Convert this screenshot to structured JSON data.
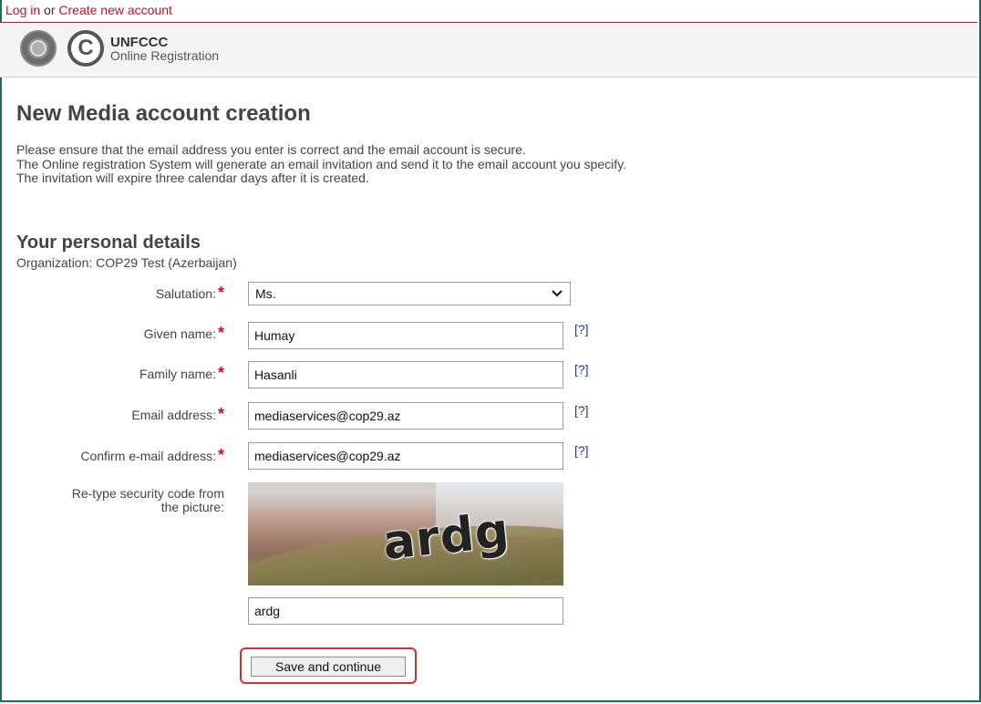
{
  "topbar": {
    "login": "Log in",
    "or": "or",
    "create": "Create new account"
  },
  "header": {
    "brand_title": "UNFCCC",
    "brand_subtitle": "Online Registration",
    "cc_symbol": "C"
  },
  "page": {
    "title": "New Media account creation",
    "intro": [
      "Please ensure that the email address you enter is correct and the email account is secure.",
      "The Online registration System will generate an email invitation and send it to the email account you specify.",
      "The invitation will expire three calendar days after it is created."
    ]
  },
  "section": {
    "title": "Your personal details",
    "organization": "Organization: COP29 Test (Azerbaijan)"
  },
  "form": {
    "required_mark": "*",
    "help_link": "[?]",
    "salutation": {
      "label": "Salutation:",
      "value": "Ms."
    },
    "given_name": {
      "label": "Given name:",
      "value": "Humay"
    },
    "family_name": {
      "label": "Family name:",
      "value": "Hasanli"
    },
    "email": {
      "label": "Email address:",
      "value": "mediaservices@cop29.az"
    },
    "confirm_email": {
      "label": "Confirm e-mail address:",
      "value": "mediaservices@cop29.az"
    },
    "security": {
      "label_line1": "Re-type security code from",
      "label_line2": "the picture:",
      "captcha_text": "ardg",
      "value": "ardg"
    },
    "save_label": "Save and continue"
  },
  "colors": {
    "link_red": "#c8102e",
    "frame_green": "#1f6b5a",
    "help_blue": "#1a3f9a",
    "highlight_red": "#d32f2f"
  }
}
